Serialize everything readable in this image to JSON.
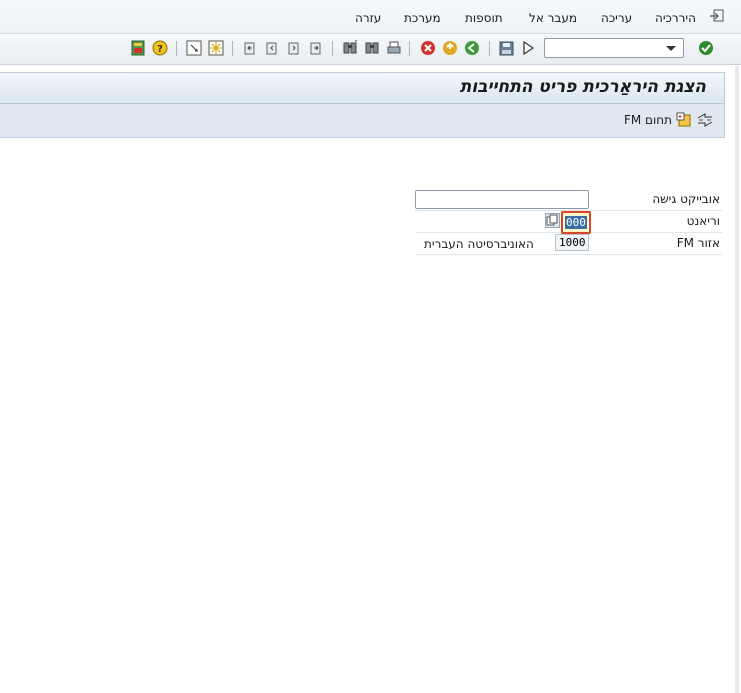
{
  "menu": {
    "items": [
      {
        "id": "hierarchy",
        "label": "היררכיה"
      },
      {
        "id": "edit",
        "label": "עריכה"
      },
      {
        "id": "goto",
        "label": "מעבר אל"
      },
      {
        "id": "extras",
        "label": "תוספות"
      },
      {
        "id": "system",
        "label": "מערכת"
      },
      {
        "id": "help",
        "label": "עזרה"
      }
    ]
  },
  "toolbar": {
    "command_field_value": "",
    "icons": [
      "enter-check-icon",
      "dropdown-icon",
      "play-icon",
      "save-icon",
      "back-icon",
      "exit-icon",
      "cancel-icon",
      "print-icon",
      "find-icon",
      "find-next-icon",
      "first-page-icon",
      "prev-page-icon",
      "next-page-icon",
      "last-page-icon",
      "create-session-icon",
      "shortcut-icon",
      "help-icon",
      "customize-layout-icon"
    ]
  },
  "title": {
    "text": "הצגת היראַרכית פריט התחייבות"
  },
  "app_toolbar": {
    "fm_area_label": "תחום FM"
  },
  "form": {
    "access_object": {
      "label": "אובייקט גישה",
      "value": ""
    },
    "variant": {
      "label": "וריאנט",
      "value": "000"
    },
    "fm_area": {
      "label": "אזור FM",
      "value": "1000",
      "description": "האוניברסיטה העברית"
    }
  },
  "colors": {
    "accent_red": "#d8472a",
    "selection_blue": "#3a6ea5",
    "title_gradient_end": "#dce6ef"
  }
}
